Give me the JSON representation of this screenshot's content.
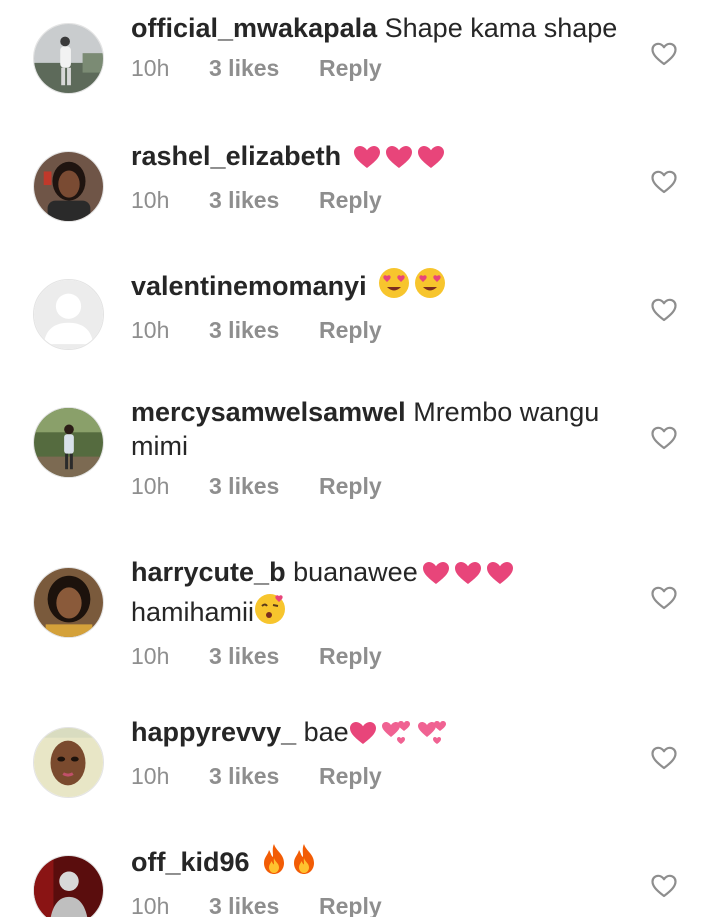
{
  "comments": [
    {
      "username": "official_mwakapala",
      "text": "Shape kama shape",
      "emojis": [],
      "time": "10h",
      "likes": "3 likes",
      "reply": "Reply",
      "avatar": "outdoor-person-photo"
    },
    {
      "username": "rashel_elizabeth",
      "text": "",
      "emojis": [
        "pink-heart",
        "pink-heart",
        "pink-heart"
      ],
      "time": "10h",
      "likes": "3 likes",
      "reply": "Reply",
      "avatar": "woman-portrait-photo"
    },
    {
      "username": "valentinemomanyi",
      "text": "",
      "emojis": [
        "heart-eyes-face",
        "heart-eyes-face"
      ],
      "time": "10h",
      "likes": "3 likes",
      "reply": "Reply",
      "avatar": "default-profile-silhouette"
    },
    {
      "username": "mercysamwelsamwel",
      "text": "Mrembo wangu mimi",
      "emojis": [],
      "time": "10h",
      "likes": "3 likes",
      "reply": "Reply",
      "avatar": "person-in-garden-photo"
    },
    {
      "username": "harrycute_b",
      "text": "buanawee",
      "text2": "hamihamii",
      "emojis": [
        "pink-heart",
        "pink-heart",
        "pink-heart"
      ],
      "emojis2": [
        "kissing-heart-face"
      ],
      "time": "10h",
      "likes": "3 likes",
      "reply": "Reply",
      "avatar": "woman-selfie-photo"
    },
    {
      "username": "happyrevvy_",
      "text": "bae",
      "emojis": [
        "pink-heart",
        "two-hearts",
        "two-hearts"
      ],
      "time": "10h",
      "likes": "3 likes",
      "reply": "Reply",
      "avatar": "woman-close-up-photo"
    },
    {
      "username": "off_kid96",
      "text": "",
      "emojis": [
        "fire",
        "fire"
      ],
      "time": "10h",
      "likes": "3 likes",
      "reply": "Reply",
      "avatar": "man-red-background-photo"
    }
  ],
  "colors": {
    "username": "#262626",
    "meta": "#8e8e8e",
    "heart_outline": "#8e8e8e",
    "emoji_pink": "#e8457a"
  }
}
